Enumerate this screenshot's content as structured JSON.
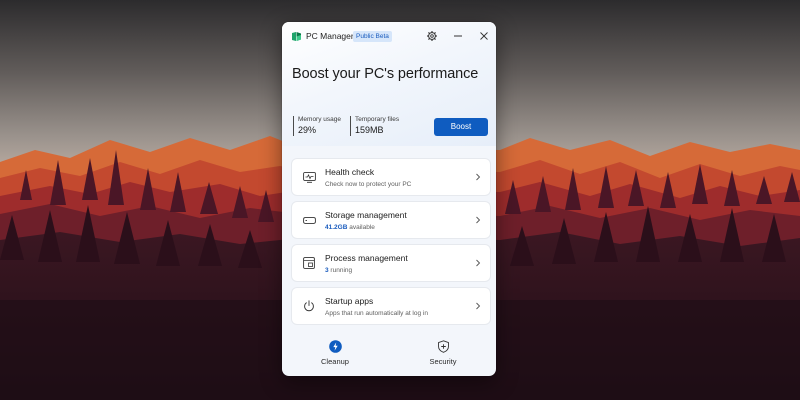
{
  "app": {
    "name": "PC Manager",
    "badge": "Public Beta"
  },
  "titlebar": {
    "icons": [
      "settings-icon",
      "minimize-icon",
      "close-icon"
    ]
  },
  "headline": "Boost your PC's performance",
  "stats": {
    "memory": {
      "label": "Memory usage",
      "value": "29%"
    },
    "temp": {
      "label": "Temporary files",
      "value": "159MB"
    }
  },
  "boost_label": "Boost",
  "cards": [
    {
      "title": "Health check",
      "subtitle": "Check now to protect your PC",
      "icon": "health-check-icon"
    },
    {
      "title": "Storage management",
      "highlight": "41.2GB",
      "subtitle_rest": " available",
      "icon": "storage-icon"
    },
    {
      "title": "Process management",
      "highlight": "3",
      "subtitle_rest": " running",
      "icon": "process-icon"
    },
    {
      "title": "Startup apps",
      "subtitle": "Apps that run automatically at log in",
      "icon": "power-icon"
    }
  ],
  "nav": {
    "cleanup": {
      "label": "Cleanup",
      "icon": "lightning-icon",
      "active": true
    },
    "security": {
      "label": "Security",
      "icon": "shield-icon",
      "active": false
    }
  },
  "colors": {
    "accent": "#0f5cc0",
    "badge_bg": "#d6e6fa",
    "window_bg": "#f3f6fb"
  }
}
